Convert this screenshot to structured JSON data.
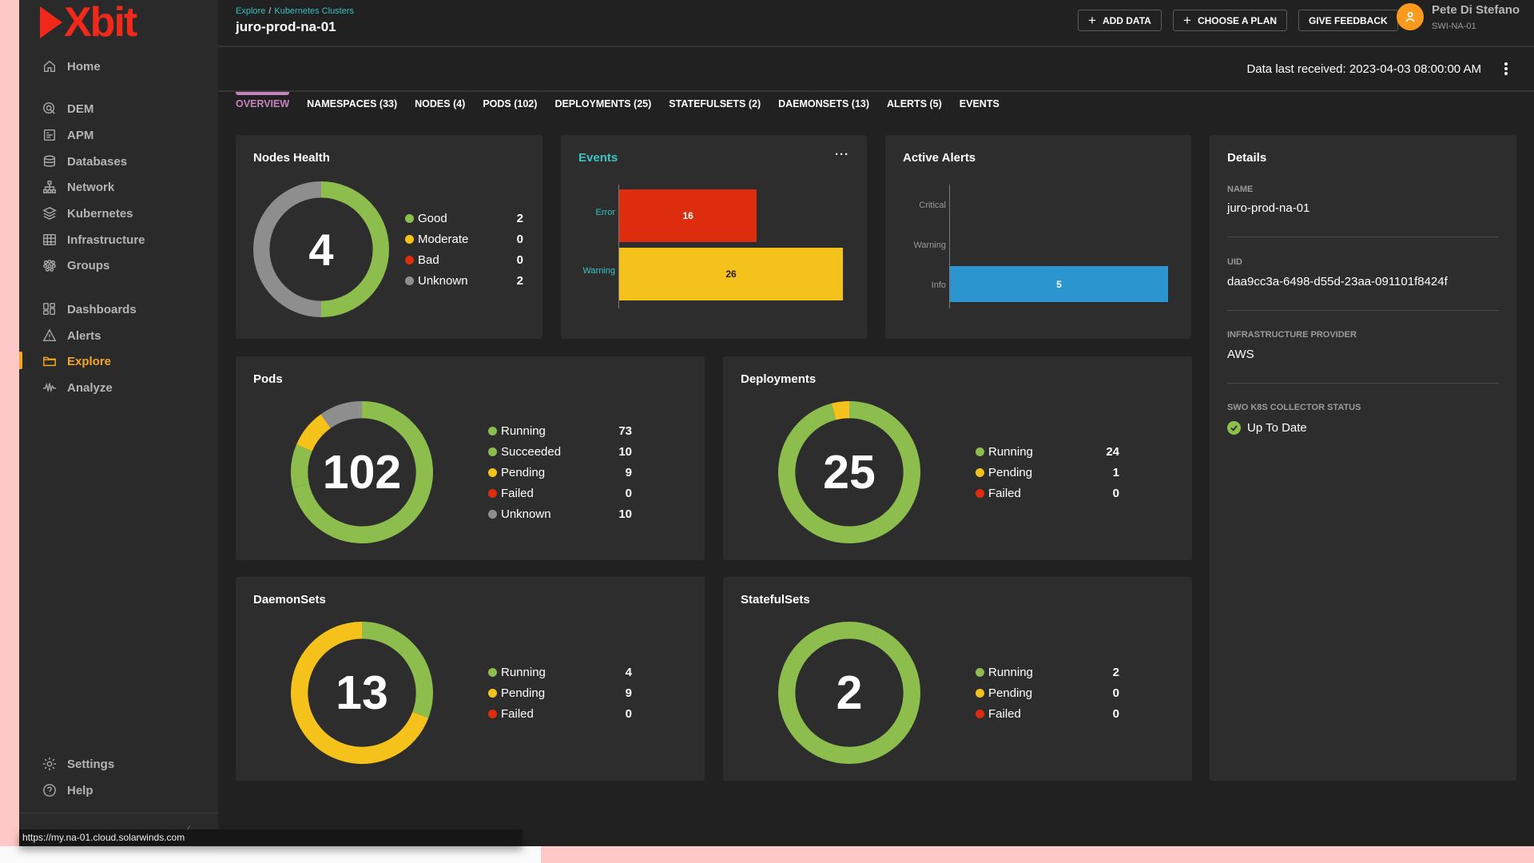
{
  "app": {
    "logo_text": "Xbit",
    "brand_color": "#f0291a",
    "status_url": "https://my.na-01.cloud.solarwinds.com"
  },
  "sidebar": {
    "items": [
      {
        "label": "Home",
        "icon": "home-icon"
      },
      {
        "label": "DEM",
        "icon": "dem-icon"
      },
      {
        "label": "APM",
        "icon": "apm-icon"
      },
      {
        "label": "Databases",
        "icon": "database-icon"
      },
      {
        "label": "Network",
        "icon": "network-icon"
      },
      {
        "label": "Kubernetes",
        "icon": "layers-icon"
      },
      {
        "label": "Infrastructure",
        "icon": "grid-icon"
      },
      {
        "label": "Groups",
        "icon": "groups-icon"
      },
      {
        "label": "Dashboards",
        "icon": "dashboard-icon"
      },
      {
        "label": "Alerts",
        "icon": "warning-icon"
      },
      {
        "label": "Explore",
        "icon": "folder-icon",
        "active": true
      },
      {
        "label": "Analyze",
        "icon": "pulse-icon"
      }
    ],
    "footer": [
      {
        "label": "Settings",
        "icon": "gear-icon"
      },
      {
        "label": "Help",
        "icon": "help-icon"
      }
    ],
    "active_color": "#f5a623"
  },
  "header": {
    "breadcrumb": [
      "Explore",
      "Kubernetes Clusters"
    ],
    "breadcrumb_sep": "/",
    "title": "juro-prod-na-01",
    "buttons": {
      "add_data": "ADD DATA",
      "choose_plan": "CHOOSE A PLAN",
      "feedback": "GIVE FEEDBACK"
    },
    "user": {
      "name": "Pete Di Stefano",
      "org": "SWI-NA-01"
    }
  },
  "subheader": {
    "last_received": "Data last received: 2023-04-03 08:00:00 AM"
  },
  "tabs": [
    {
      "label": "OVERVIEW",
      "active": true
    },
    {
      "label": "NAMESPACES (33)"
    },
    {
      "label": "NODES (4)"
    },
    {
      "label": "PODS (102)"
    },
    {
      "label": "DEPLOYMENTS (25)"
    },
    {
      "label": "STATEFULSETS (2)"
    },
    {
      "label": "DAEMONSETS (13)"
    },
    {
      "label": "ALERTS (5)"
    },
    {
      "label": "EVENTS"
    }
  ],
  "colors": {
    "good": "#8cbd4d",
    "pending": "#f5c21b",
    "bad": "#dd2c0e",
    "unknown": "#8e8e8e",
    "info": "#2b95cf"
  },
  "details": {
    "title": "Details",
    "fields": [
      {
        "label": "NAME",
        "value": "juro-prod-na-01"
      },
      {
        "label": "UID",
        "value": "daa9cc3a-6498-d55d-23aa-091101f8424f"
      },
      {
        "label": "INFRASTRUCTURE PROVIDER",
        "value": "AWS"
      },
      {
        "label": "SWO K8S COLLECTOR STATUS",
        "value": "Up To Date"
      }
    ]
  },
  "chart_data": [
    {
      "id": "nodes",
      "type": "pie",
      "title": "Nodes Health",
      "total": "4",
      "categories": [
        "Good",
        "Moderate",
        "Bad",
        "Unknown"
      ],
      "values": [
        2,
        0,
        0,
        2
      ],
      "colors": [
        "#8cbd4d",
        "#f5c21b",
        "#dd2c0e",
        "#8e8e8e"
      ],
      "legend": "right"
    },
    {
      "id": "events",
      "type": "bar",
      "orientation": "horizontal",
      "title": "Events",
      "categories": [
        "Error",
        "Warning"
      ],
      "values": [
        16,
        26
      ],
      "colors": [
        "#dd2c0e",
        "#f5c21b"
      ],
      "label_colors": [
        "#ffffff",
        "#1d1d1d"
      ],
      "xlim": [
        0,
        26
      ]
    },
    {
      "id": "alerts",
      "type": "bar",
      "orientation": "horizontal",
      "title": "Active Alerts",
      "categories": [
        "Critical",
        "Warning",
        "Info"
      ],
      "values": [
        0,
        0,
        5
      ],
      "colors": [
        "#dd2c0e",
        "#f5c21b",
        "#2b95cf"
      ],
      "label_colors": [
        "#ffffff",
        "#1d1d1d",
        "#ffffff"
      ],
      "xlim": [
        0,
        5
      ]
    },
    {
      "id": "pods",
      "type": "pie",
      "title": "Pods",
      "total": "102",
      "categories": [
        "Running",
        "Succeeded",
        "Pending",
        "Failed",
        "Unknown"
      ],
      "values": [
        73,
        10,
        9,
        0,
        10
      ],
      "colors": [
        "#8cbd4d",
        "#8cbd4d",
        "#f5c21b",
        "#dd2c0e",
        "#8e8e8e"
      ],
      "legend": "right"
    },
    {
      "id": "deployments",
      "type": "pie",
      "title": "Deployments",
      "total": "25",
      "categories": [
        "Running",
        "Pending",
        "Failed"
      ],
      "values": [
        24,
        1,
        0
      ],
      "colors": [
        "#8cbd4d",
        "#f5c21b",
        "#dd2c0e"
      ],
      "legend": "right"
    },
    {
      "id": "daemonsets",
      "type": "pie",
      "title": "DaemonSets",
      "total": "13",
      "categories": [
        "Running",
        "Pending",
        "Failed"
      ],
      "values": [
        4,
        9,
        0
      ],
      "colors": [
        "#8cbd4d",
        "#f5c21b",
        "#dd2c0e"
      ],
      "legend": "right"
    },
    {
      "id": "statefulsets",
      "type": "pie",
      "title": "StatefulSets",
      "total": "2",
      "categories": [
        "Running",
        "Pending",
        "Failed"
      ],
      "values": [
        2,
        0,
        0
      ],
      "colors": [
        "#8cbd4d",
        "#f5c21b",
        "#dd2c0e"
      ],
      "legend": "right"
    }
  ]
}
